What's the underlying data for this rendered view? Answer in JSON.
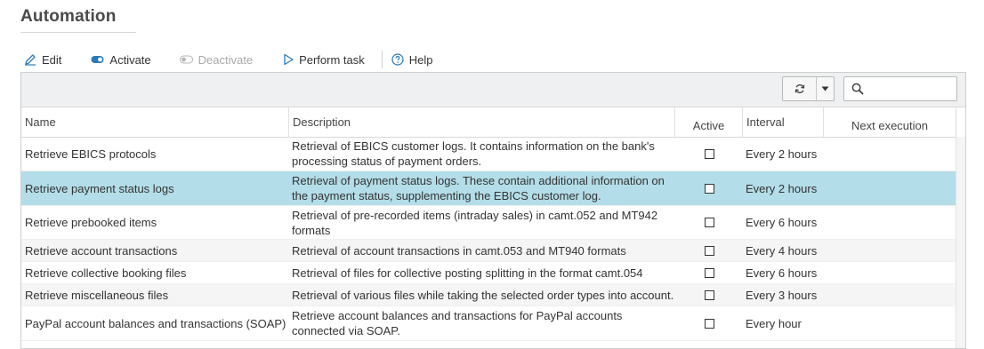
{
  "page": {
    "title": "Automation"
  },
  "toolbar": {
    "edit": "Edit",
    "activate": "Activate",
    "deactivate": "Deactivate",
    "perform": "Perform task",
    "help": "Help"
  },
  "search": {
    "placeholder": "",
    "value": ""
  },
  "table": {
    "columns": {
      "name": "Name",
      "description": "Description",
      "active": "Active",
      "interval": "Interval",
      "next": "Next execution"
    },
    "rows": [
      {
        "name": "Retrieve EBICS protocols",
        "description": "Retrieval of EBICS customer logs. It contains information on the bank's processing status of payment orders.",
        "active": false,
        "interval": "Every 2 hours",
        "next": ""
      },
      {
        "name": "Retrieve payment status logs",
        "description": "Retrieval of payment status logs. These contain additional information on the payment status, supplementing the EBICS customer log.",
        "active": false,
        "interval": "Every 2 hours",
        "next": "",
        "selected": true
      },
      {
        "name": "Retrieve prebooked items",
        "description": "Retrieval of pre-recorded items (intraday sales) in camt.052 and MT942 formats",
        "active": false,
        "interval": "Every 6 hours",
        "next": ""
      },
      {
        "name": "Retrieve account transactions",
        "description": "Retrieval of account transactions in camt.053 and MT940 formats",
        "active": false,
        "interval": "Every 4 hours",
        "next": ""
      },
      {
        "name": "Retrieve collective booking files",
        "description": "Retrieval of files for collective posting splitting in the format camt.054",
        "active": false,
        "interval": "Every 6 hours",
        "next": ""
      },
      {
        "name": "Retrieve miscellaneous files",
        "description": "Retrieval of various files while taking the selected order types into account.",
        "active": false,
        "interval": "Every 3 hours",
        "next": ""
      },
      {
        "name": "PayPal account balances and transactions (SOAP)",
        "description": "Retrieve account balances and transactions for PayPal accounts connected via SOAP.",
        "active": false,
        "interval": "Every hour",
        "next": ""
      }
    ]
  },
  "colors": {
    "accent": "#2a7ab8",
    "selected_row": "#b3dde8",
    "alt_row": "#f5f5f5",
    "disabled": "#a9a9a9"
  },
  "icons": {
    "edit": "pencil-icon",
    "activate": "toggle-on-icon",
    "deactivate": "toggle-off-icon",
    "perform": "play-icon",
    "help": "help-circle-icon",
    "refresh": "refresh-icon",
    "dropdown": "caret-down-icon",
    "search": "search-icon"
  }
}
